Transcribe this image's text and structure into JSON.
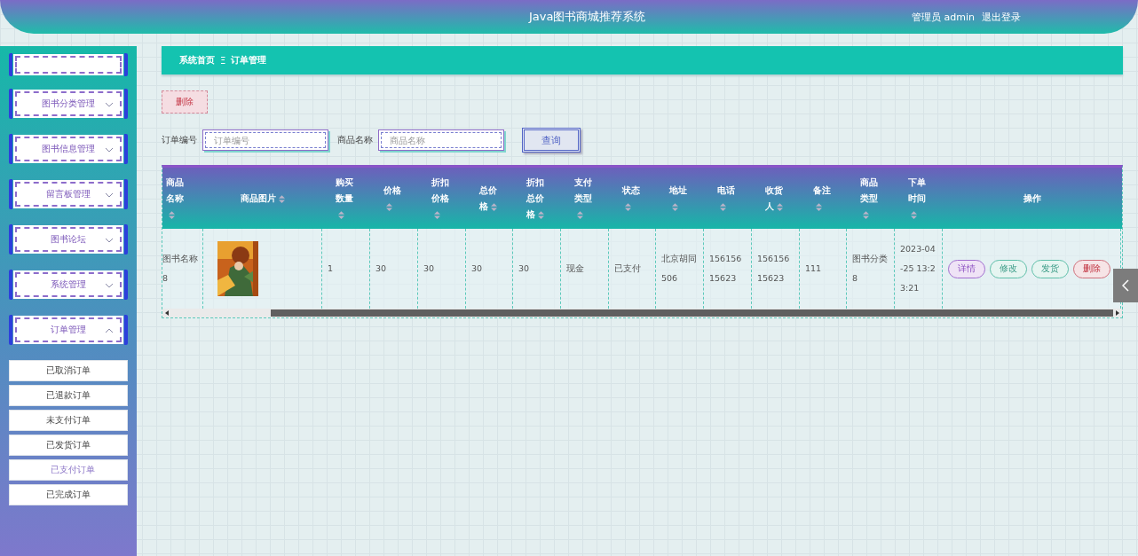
{
  "header": {
    "title": "Java图书商城推荐系统",
    "user": "管理员 admin",
    "logout": "退出登录"
  },
  "sidebar": {
    "items": [
      {
        "label": "图书分类管理",
        "expanded": false
      },
      {
        "label": "图书信息管理",
        "expanded": false
      },
      {
        "label": "留言板管理",
        "expanded": false
      },
      {
        "label": "图书论坛",
        "expanded": false
      },
      {
        "label": "系统管理",
        "expanded": false
      },
      {
        "label": "订单管理",
        "expanded": true,
        "children": [
          {
            "label": "已取消订单",
            "selected": false
          },
          {
            "label": "已退款订单",
            "selected": false
          },
          {
            "label": "未支付订单",
            "selected": false
          },
          {
            "label": "已发货订单",
            "selected": false
          },
          {
            "label": "已支付订单",
            "selected": true
          },
          {
            "label": "已完成订单",
            "selected": false
          }
        ]
      }
    ]
  },
  "breadcrumb": {
    "home": "系统首页",
    "separator": "Ξ",
    "current": "订单管理"
  },
  "toolbar": {
    "delete": "删除"
  },
  "search": {
    "fields": [
      {
        "label": "订单编号",
        "placeholder": "订单编号"
      },
      {
        "label": "商品名称",
        "placeholder": "商品名称"
      }
    ],
    "button": "查询"
  },
  "table": {
    "columns": [
      {
        "label": "商品名称",
        "sortable": true
      },
      {
        "label": "商品图片",
        "sortable": true
      },
      {
        "label": "购买数量",
        "sortable": true
      },
      {
        "label": "价格",
        "sortable": true
      },
      {
        "label": "折扣价格",
        "sortable": true
      },
      {
        "label": "总价格",
        "sortable": true
      },
      {
        "label": "折扣总价格",
        "sortable": true
      },
      {
        "label": "支付类型",
        "sortable": true
      },
      {
        "label": "状态",
        "sortable": true
      },
      {
        "label": "地址",
        "sortable": true
      },
      {
        "label": "电话",
        "sortable": true
      },
      {
        "label": "收货人",
        "sortable": true
      },
      {
        "label": "备注",
        "sortable": true
      },
      {
        "label": "商品类型",
        "sortable": true
      },
      {
        "label": "下单时间",
        "sortable": true
      },
      {
        "label": "操作",
        "sortable": false
      }
    ],
    "rows": [
      {
        "cells": [
          {
            "kind": "text",
            "text": "图书名称8"
          },
          {
            "kind": "picture"
          },
          {
            "kind": "text",
            "text": "1"
          },
          {
            "kind": "text",
            "text": "30"
          },
          {
            "kind": "text",
            "text": "30"
          },
          {
            "kind": "text",
            "text": "30"
          },
          {
            "kind": "text",
            "text": "30"
          },
          {
            "kind": "text",
            "text": "现金"
          },
          {
            "kind": "text",
            "text": "已支付"
          },
          {
            "kind": "text",
            "text": "北京胡同506"
          },
          {
            "kind": "text",
            "text": "15615615623"
          },
          {
            "kind": "text",
            "text": "15615615623"
          },
          {
            "kind": "text",
            "text": "111"
          },
          {
            "kind": "text",
            "text": "图书分类8"
          },
          {
            "kind": "text",
            "text": "2023-04-25 13:23:21"
          },
          {
            "kind": "actions",
            "actions": [
              {
                "label": "详情",
                "kind": "detail"
              },
              {
                "label": "修改",
                "kind": "edit"
              },
              {
                "label": "发货",
                "kind": "ship"
              },
              {
                "label": "删除",
                "kind": "delete"
              }
            ]
          }
        ]
      }
    ]
  }
}
